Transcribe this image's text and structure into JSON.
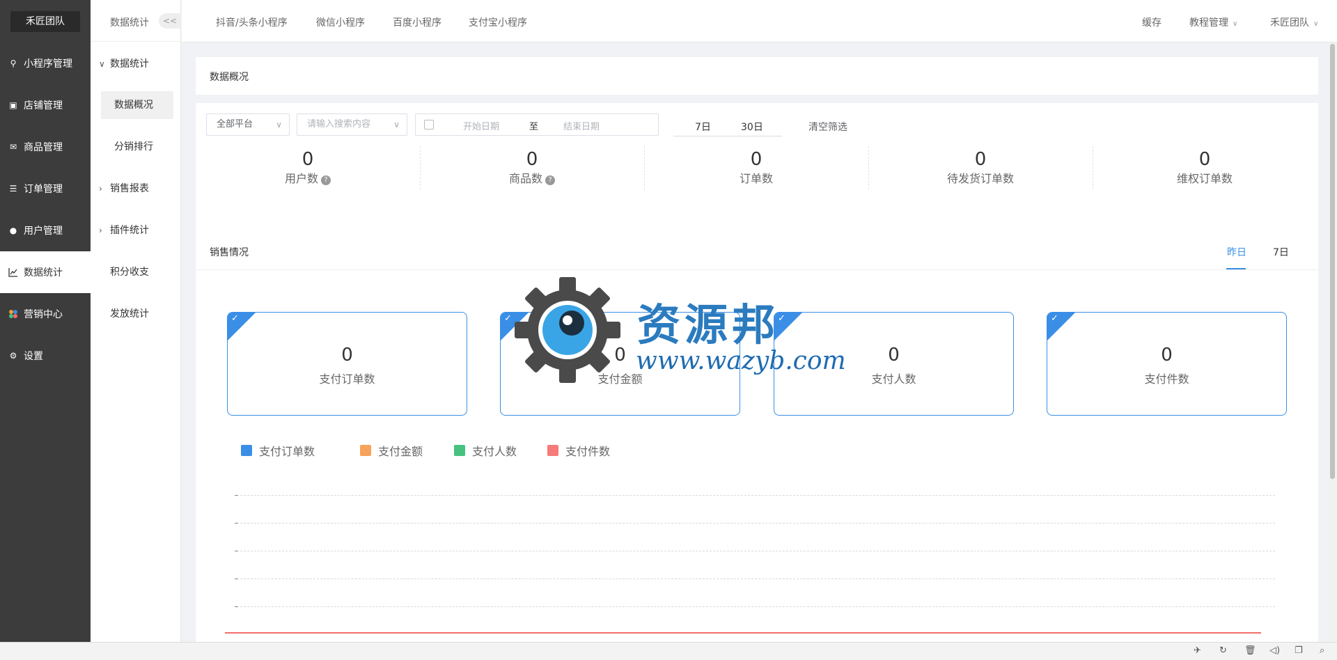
{
  "brand": "禾匠团队",
  "left_nav": [
    {
      "label": "小程序管理",
      "icon": "link-icon"
    },
    {
      "label": "店铺管理",
      "icon": "shop-icon"
    },
    {
      "label": "商品管理",
      "icon": "goods-icon"
    },
    {
      "label": "订单管理",
      "icon": "order-icon"
    },
    {
      "label": "用户管理",
      "icon": "user-icon"
    },
    {
      "label": "数据统计",
      "icon": "chart-icon",
      "active": true
    },
    {
      "label": "营销中心",
      "icon": "marketing-icon"
    },
    {
      "label": "设置",
      "icon": "gear-icon"
    }
  ],
  "sub_nav": {
    "title": "数据统计",
    "collapse": "<<",
    "items": [
      {
        "label": "数据统计",
        "expanded": true
      },
      {
        "label": "数据概况",
        "active": true
      },
      {
        "label": "分销排行"
      },
      {
        "label": "销售报表",
        "collapsed": true
      },
      {
        "label": "插件统计",
        "collapsed": true
      },
      {
        "label": "积分收支"
      },
      {
        "label": "发放统计"
      }
    ]
  },
  "topbar": {
    "tabs": [
      "抖音/头条小程序",
      "微信小程序",
      "百度小程序",
      "支付宝小程序"
    ],
    "cache": "缓存",
    "tutorial": "教程管理",
    "team": "禾匠团队"
  },
  "overview": {
    "title": "数据概况",
    "platform_select": "全部平台",
    "search_placeholder": "请输入搜索内容",
    "start_placeholder": "开始日期",
    "range_sep": "至",
    "end_placeholder": "结束日期",
    "quick_7": "7日",
    "quick_30": "30日",
    "clear": "清空筛选",
    "stats": [
      {
        "value": "0",
        "label": "用户数",
        "help": true
      },
      {
        "value": "0",
        "label": "商品数",
        "help": true
      },
      {
        "value": "0",
        "label": "订单数"
      },
      {
        "value": "0",
        "label": "待发货订单数"
      },
      {
        "value": "0",
        "label": "维权订单数"
      }
    ]
  },
  "sales": {
    "title": "销售情况",
    "tabs": [
      "昨日",
      "7日"
    ],
    "active_tab": "昨日",
    "kpis": [
      {
        "value": "0",
        "label": "支付订单数"
      },
      {
        "value": "0",
        "label": "支付金额"
      },
      {
        "value": "0",
        "label": "支付人数"
      },
      {
        "value": "0",
        "label": "支付件数"
      }
    ],
    "legend": [
      {
        "name": "支付订单数",
        "color": "#3a8ee6"
      },
      {
        "name": "支付金额",
        "color": "#f7a35c"
      },
      {
        "name": "支付人数",
        "color": "#47c27f"
      },
      {
        "name": "支付件数",
        "color": "#f77a7a"
      }
    ]
  },
  "watermark": {
    "text": "资源邦",
    "url": "www.wazyb.com"
  }
}
